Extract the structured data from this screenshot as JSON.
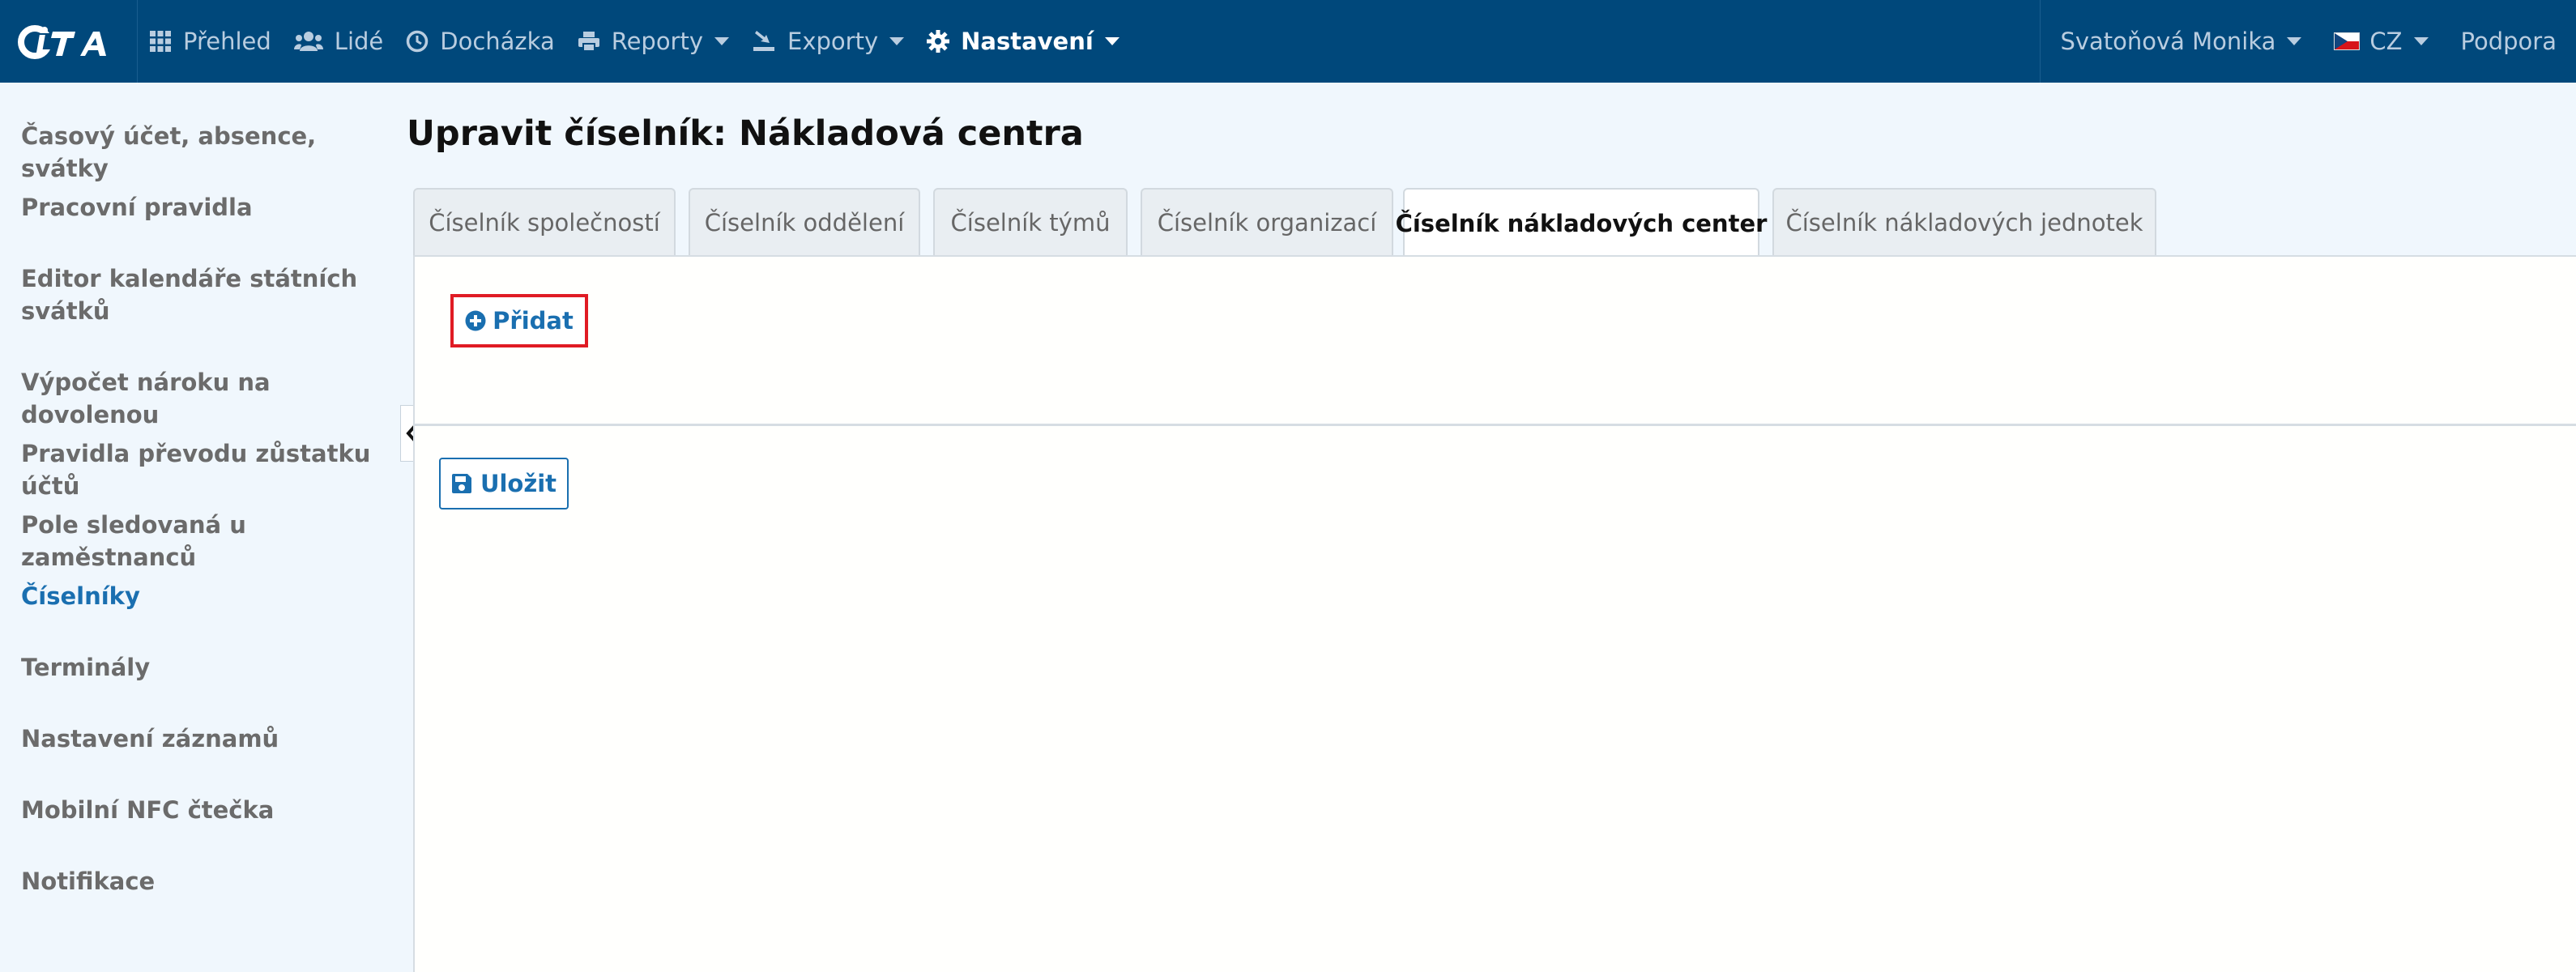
{
  "app": {
    "logo_icon": "cita-logo"
  },
  "topnav": {
    "items": [
      {
        "label": "Přehled",
        "icon": "grid-icon"
      },
      {
        "label": "Lidé",
        "icon": "users-icon"
      },
      {
        "label": "Docházka",
        "icon": "clock-icon"
      },
      {
        "label": "Reporty",
        "icon": "printer-icon"
      },
      {
        "label": "Exporty",
        "icon": "export-icon"
      },
      {
        "label": "Nastavení",
        "icon": "gear-icon"
      }
    ],
    "user": "Svatoňová Monika",
    "language": "CZ",
    "support": "Podpora"
  },
  "sidebar": {
    "items": [
      {
        "label": "Časový účet, absence, svátky"
      },
      {
        "label": "Pracovní pravidla"
      },
      {
        "label": "Editor kalendáře státních svátků"
      },
      {
        "label": "Výpočet nároku na dovolenou"
      },
      {
        "label": "Pravidla převodu zůstatku účtů"
      },
      {
        "label": "Pole sledovaná u zaměstnanců"
      },
      {
        "label": "Číselníky"
      },
      {
        "label": "Terminály"
      },
      {
        "label": "Nastavení záznamů"
      },
      {
        "label": "Mobilní NFC čtečka"
      },
      {
        "label": "Notifikace"
      }
    ],
    "active_index": 6
  },
  "main": {
    "title": "Upravit číselník: Nákladová centra",
    "tabs": [
      {
        "label": "Číselník společností"
      },
      {
        "label": "Číselník oddělení"
      },
      {
        "label": "Číselník týmů"
      },
      {
        "label": "Číselník organizací"
      },
      {
        "label": "Číselník nákladových center"
      },
      {
        "label": "Číselník nákladových jednotek"
      }
    ],
    "active_tab_index": 4,
    "add_label": "Přidat",
    "save_label": "Uložit"
  },
  "colors": {
    "topbar": "#00487b",
    "accent": "#1a6fb0",
    "highlight_border": "#e01b24",
    "background": "#f0f7fd"
  }
}
